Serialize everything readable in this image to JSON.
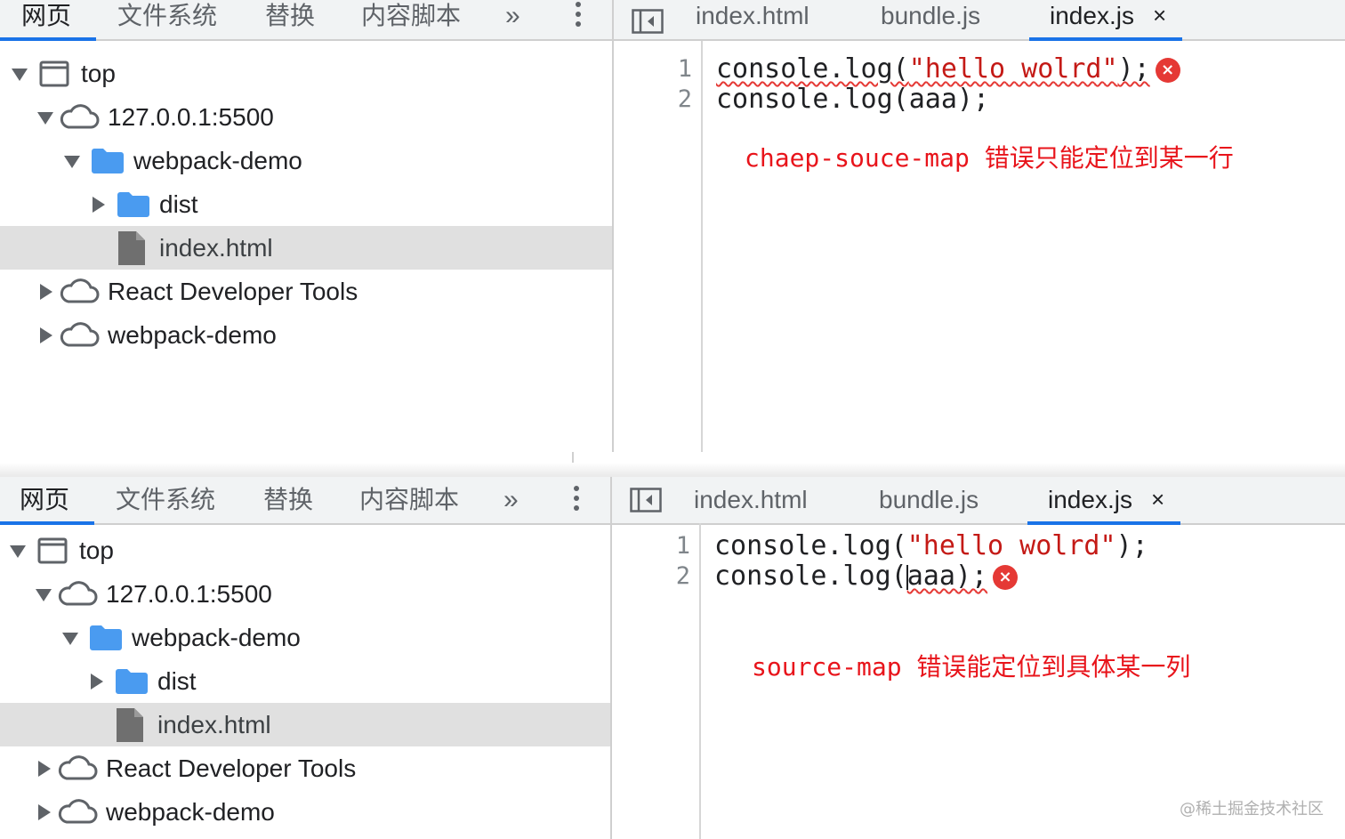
{
  "panels": [
    {
      "nav_tabs": [
        "网页",
        "文件系统",
        "替换",
        "内容脚本"
      ],
      "more_glyph": "»",
      "tree": [
        "top",
        "127.0.0.1:5500",
        "webpack-demo",
        "dist",
        "index.html",
        "React Developer Tools",
        "webpack-demo"
      ],
      "editor_tabs": [
        "index.html",
        "bundle.js",
        "index.js"
      ],
      "close_glyph": "×",
      "line_numbers": [
        "1",
        "2"
      ],
      "code": {
        "l1_fn": "console.log(",
        "l1_str": "\"hello wolrd\"",
        "l1_end": ");",
        "l2_pre": "console.log(aaa);",
        "l2_arg": "",
        "l2_end": ""
      },
      "error_glyph": "×",
      "annotation": "chaep-souce-map 错误只能定位到某一行"
    },
    {
      "nav_tabs": [
        "网页",
        "文件系统",
        "替换",
        "内容脚本"
      ],
      "more_glyph": "»",
      "tree": [
        "top",
        "127.0.0.1:5500",
        "webpack-demo",
        "dist",
        "index.html",
        "React Developer Tools",
        "webpack-demo"
      ],
      "editor_tabs": [
        "index.html",
        "bundle.js",
        "index.js"
      ],
      "close_glyph": "×",
      "line_numbers": [
        "1",
        "2"
      ],
      "code": {
        "l1_fn": "console.log(",
        "l1_str": "\"hello wolrd\"",
        "l1_end": ");",
        "l2_pre": "console.log(",
        "l2_arg": "aaa);",
        "l2_end": ""
      },
      "error_glyph": "×",
      "annotation": "source-map 错误能定位到具体某一列"
    }
  ],
  "watermark": "@稀土掘金技术社区",
  "colors": {
    "accent": "#1a73e8",
    "error": "#e53935",
    "annotation": "#e8141b",
    "folder": "#4a9bf0",
    "string": "#c41a16"
  }
}
